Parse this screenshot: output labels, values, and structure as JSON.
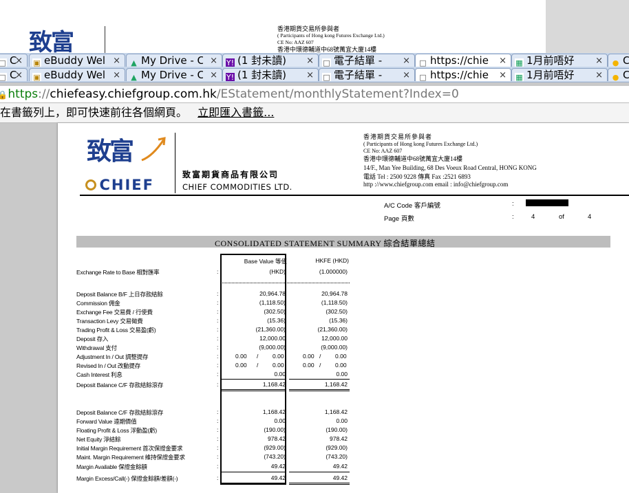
{
  "background_page": {
    "logo_chars": "致富",
    "participant_cn": "香港期貨交易所參與者",
    "participant_en": "( Participants  of Hong kong Futures Exchange Ltd.)",
    "ce_no": "CE No: AAZ 607",
    "address_cn": "香港中環德輔道中68號萬宜大廈14樓"
  },
  "tab_rows": [
    {
      "tabs": [
        {
          "icon": "blank-page-icon",
          "label": "C",
          "close": "×"
        },
        {
          "icon": "ebuddy-icon",
          "label": "eBuddy Wel",
          "close": "×"
        },
        {
          "icon": "google-drive-icon",
          "label": "My Drive - C",
          "close": "×"
        },
        {
          "icon": "yahoo-mail-icon",
          "label": "(1 封未讀)",
          "close": "×"
        },
        {
          "icon": "blank-page-icon",
          "label": "電子結單 -",
          "close": "×"
        },
        {
          "icon": "blank-page-icon",
          "label": "https://chie",
          "close": "×"
        },
        {
          "icon": "spreadsheet-icon",
          "label": "1月前唔好",
          "close": "×"
        },
        {
          "icon": "chat-bubble-icon",
          "label": "C",
          "close": ""
        }
      ]
    },
    {
      "tabs": [
        {
          "icon": "blank-page-icon",
          "label": "C",
          "close": "×"
        },
        {
          "icon": "ebuddy-icon",
          "label": "eBuddy Wel",
          "close": "×"
        },
        {
          "icon": "google-drive-icon",
          "label": "My Drive - C",
          "close": "×"
        },
        {
          "icon": "yahoo-mail-icon",
          "label": "(1 封未讀)",
          "close": "×"
        },
        {
          "icon": "blank-page-icon",
          "label": "電子結單 -",
          "close": "×"
        },
        {
          "icon": "blank-page-icon",
          "label": "https://chie",
          "close": "×"
        },
        {
          "icon": "spreadsheet-icon",
          "label": "1月前唔好",
          "close": "×"
        },
        {
          "icon": "chat-bubble-icon",
          "label": "C",
          "close": ""
        }
      ]
    }
  ],
  "address_bar": {
    "lock_icon": "lock-icon",
    "scheme": "https",
    "sep": "://",
    "host": "chiefeasy.chiefgroup.com.hk",
    "path": "/EStatement/monthlyStatement?Index=0"
  },
  "bookmark_bar": {
    "message": "在書籤列上，即可快速前往各個網頁。",
    "link": "立即匯入書籤..."
  },
  "statement": {
    "logo_chars": "致富",
    "logo_brand": "CHIEF",
    "company_cn": "致富期貨商品有限公司",
    "company_en": "CHIEF COMMODITIES LTD.",
    "participant_cn": "香港期貨交易所參與者",
    "participant_en": "( Participants  of Hong kong Futures Exchange Ltd.)",
    "ce_no": "CE No: AAZ 607",
    "address_cn": "香港中環德輔道中68號萬宜大廈14樓",
    "address_en": "14/F., Man Yee Building, 68 Des Voeux Road Central, HONG KONG",
    "phone": "電話 Tel : 2500 9228    傳真 Fax :2521 6893",
    "web_email": "http ://www.chiefgroup.com    email : info@chiefgroup.com",
    "ac_code_label": "A/C Code 客戶編號",
    "page_label": "Page 頁數",
    "colon": ":",
    "page_current": "4",
    "page_of": "of",
    "page_total": "4",
    "summary_title": "CONSOLIDATED  STATEMENT  SUMMARY  綜合結單總結",
    "col_headers": [
      "Base Value 等值",
      "HKFE (HKD)"
    ],
    "exchange_rate": {
      "label": "Exchange Rate to Base 相對匯率",
      "a": "(HKD)",
      "b": "(1.000000)"
    },
    "rows1": [
      {
        "label": "Deposit Balance B/F 上日存款結餘",
        "a": "20,964.78",
        "b": "20,964.78"
      },
      {
        "label": "Commission 佣金",
        "a": "(1,118.50)",
        "b": "(1,118.50)"
      },
      {
        "label": "Exchange Fee 交易費 / 行使費",
        "a": "(302.50)",
        "b": "(302.50)"
      },
      {
        "label": "Transaction Levy 交易徵費",
        "a": "(15.36)",
        "b": "(15.36)"
      },
      {
        "label": "Trading Profit & Loss 交易盈(虧)",
        "a": "(21,360.00)",
        "b": "(21,360.00)"
      },
      {
        "label": "Deposit 存入",
        "a": "12,000.00",
        "b": "12,000.00"
      },
      {
        "label": "Withdrawal 支付",
        "a": "(9,000.00)",
        "b": "(9,000.00)"
      }
    ],
    "adjust_rows": [
      {
        "label": "Adjustment In / Out 調整提存",
        "a1": "0.00",
        "a2": "0.00",
        "b1": "0.00",
        "b2": "0.00"
      },
      {
        "label": "Revised In / Out 改動提存",
        "a1": "0.00",
        "a2": "0.00",
        "b1": "0.00",
        "b2": "0.00"
      }
    ],
    "slash": "/",
    "cash_interest": {
      "label": "Cash Interest 利息",
      "a": "0.00",
      "b": "0.00"
    },
    "deposit_cf": {
      "label": "Deposit Balance C/F 存款結餘滾存",
      "a": "1,168.42",
      "b": "1,168.42"
    },
    "rows2": [
      {
        "label": "Deposit Balance C/F 存款結餘滾存",
        "a": "1,168.42",
        "b": "1,168.42"
      },
      {
        "label": "Forward Value 遠期價值",
        "a": "0.00",
        "b": "0.00"
      },
      {
        "label": "Floating Profit & Loss 浮動盈(虧)",
        "a": "(190.00)",
        "b": "(190.00)"
      },
      {
        "label": "Net Equity 淨結餘",
        "a": "978.42",
        "b": "978.42"
      },
      {
        "label": "Initial Margin Requirement 首次保證金要求",
        "a": "(929.00)",
        "b": "(929.00)"
      },
      {
        "label": "Maint. Margin Requirement 維持保證金要求",
        "a": "(743.20)",
        "b": "(743.20)"
      },
      {
        "label": "Margin Available 保證金餘額",
        "a": "49.42",
        "b": "49.42"
      }
    ],
    "margin_excess": {
      "label": "Margin Excess/Call(-) 保證金餘額/差額(-)",
      "a": "49.42",
      "b": "49.42"
    }
  }
}
